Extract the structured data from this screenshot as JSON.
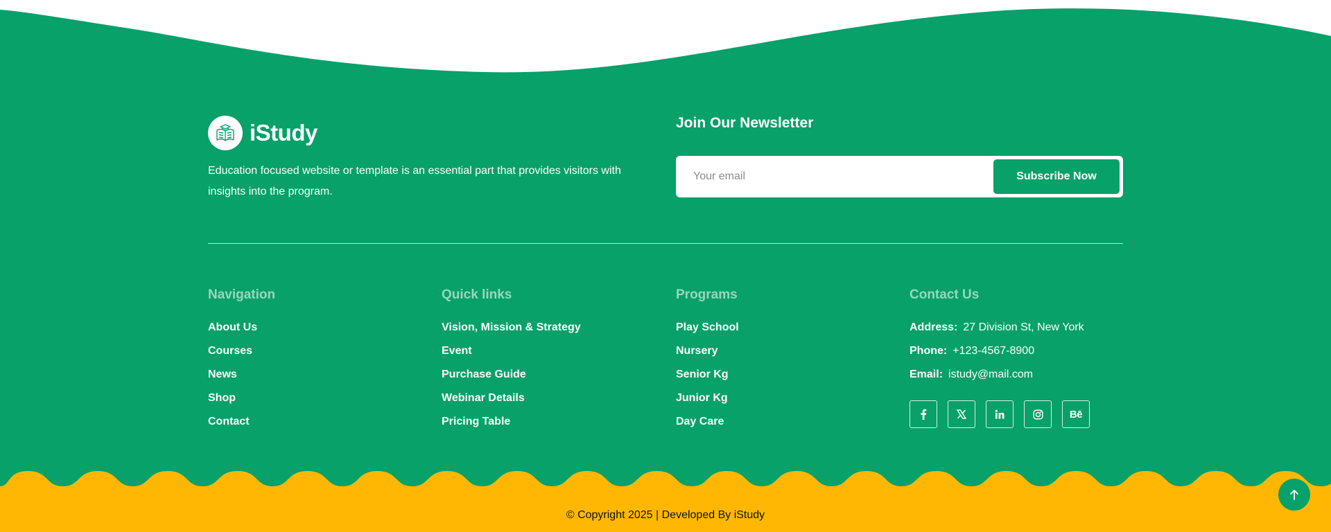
{
  "brand": {
    "name": "iStudy",
    "description": "Education focused website or template is an essential part that provides visitors with insights into the program.",
    "logo_icon": "book-icon"
  },
  "newsletter": {
    "title": "Join Our Newsletter",
    "placeholder": "Your email",
    "button_label": "Subscribe Now"
  },
  "columns": {
    "navigation": {
      "title": "Navigation",
      "links": [
        "About Us",
        "Courses",
        "News",
        "Shop",
        "Contact"
      ]
    },
    "quick_links": {
      "title": "Quick links",
      "links": [
        "Vision, Mission & Strategy",
        "Event",
        "Purchase Guide",
        "Webinar Details",
        "Pricing Table"
      ]
    },
    "programs": {
      "title": "Programs",
      "links": [
        "Play School",
        "Nursery",
        "Senior Kg",
        "Junior Kg",
        "Day Care"
      ]
    },
    "contact": {
      "title": "Contact Us",
      "address_label": "Address:",
      "address": "27 Division St, New York",
      "phone_label": "Phone:",
      "phone": "+123-4567-8900",
      "email_label": "Email:",
      "email": "istudy@mail.com",
      "socials": [
        "facebook-icon",
        "x-twitter-icon",
        "linkedin-icon",
        "instagram-icon",
        "behance-icon"
      ],
      "behance_text": "Bē"
    }
  },
  "copyright": "© Copyright 2025 | Developed By iStudy",
  "colors": {
    "green": "#07a169",
    "yellow": "#ffb703",
    "muted_heading": "#9bd6bd"
  }
}
